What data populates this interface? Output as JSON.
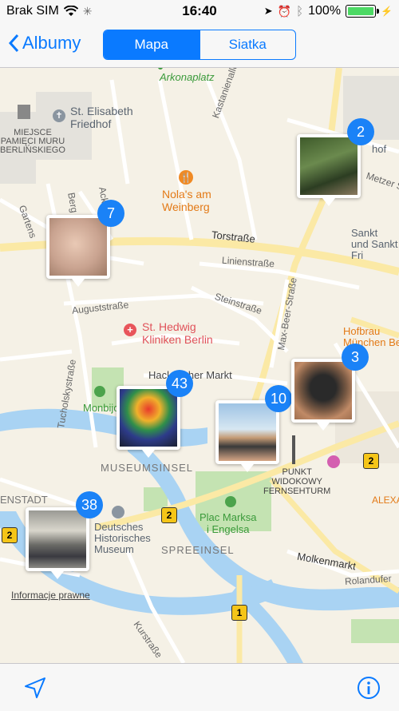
{
  "status": {
    "carrier": "Brak SIM",
    "time": "16:40",
    "battery": "100%"
  },
  "nav": {
    "back_label": "Albumy",
    "segments": [
      "Mapa",
      "Siatka"
    ]
  },
  "map": {
    "places": {
      "arkonaplatz": "Arkonaplatz",
      "friedhof": "St. Elisabeth\nFriedhof",
      "miejsce": "MIEJSCE\nPAMIĘCI MURU\nBERLIŃSKIEGO",
      "kastanienallee": "Kastanienallee",
      "nolas": "Nola's am\nWeinberg",
      "torstrasse": "Torstraße",
      "linienstrasse": "Linienstraße",
      "augusstrasse": "Auguststraße",
      "steinstrasse": "Steinstraße",
      "maxbeer": "Max-Beer-Straße",
      "hedwig": "St. Hedwig\nKliniken Berlin",
      "hackescher": "Hackescher Markt",
      "tucholsky": "Tucholskystraße",
      "hofbrau": "Hofbrau\nMünchen Berlin",
      "monbijou": "Monbijou",
      "museumsinsel": "MUSEUMSINSEL",
      "fernsehturm": "PUNKT\nWIDOKOWY\nFERNSEHTURM",
      "marksa": "Plac Marksa\ni Engelsa",
      "dhm": "Deutsches\nHistorisches\nMuseum",
      "spreeinsel": "SPREEINSEL",
      "molkenmarkt": "Molkenmarkt",
      "rolandufer": "Rolandufer",
      "kurstrasse": "Kurstraße",
      "stadt": "ENSTADT",
      "alexa": "ALEXA",
      "sankt": "Sankt\nund Sankt\nFri",
      "metzer": "Metzer Str",
      "hof": "hof",
      "gartens": "Gartens",
      "bergs": "Berg",
      "acke": "Acker",
      "legal": "Informacje prawne"
    },
    "clusters": [
      {
        "count": "2"
      },
      {
        "count": "7"
      },
      {
        "count": "43"
      },
      {
        "count": "10"
      },
      {
        "count": "3"
      },
      {
        "count": "38"
      }
    ],
    "road_badges": [
      "2",
      "2",
      "2",
      "1"
    ]
  },
  "toolbar": {
    "location_icon": "location-arrow-icon",
    "info_icon": "info-icon"
  }
}
